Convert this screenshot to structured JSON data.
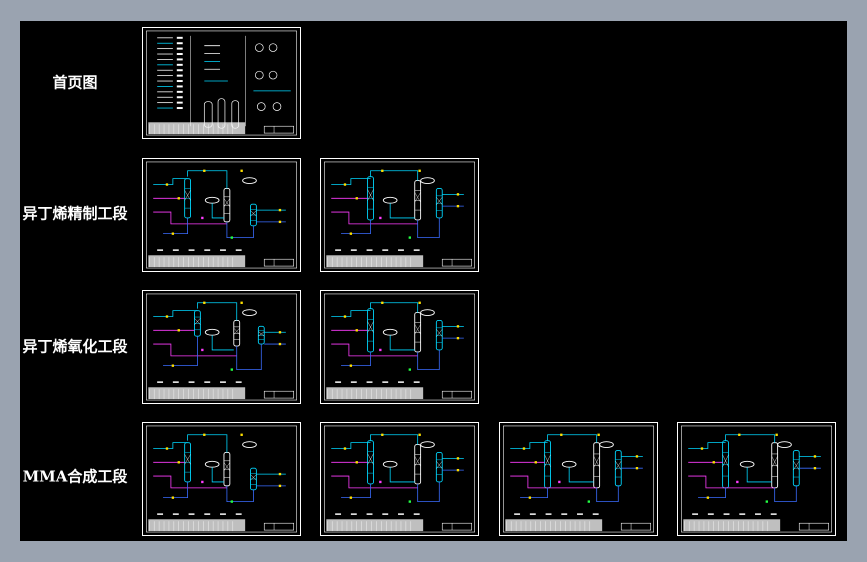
{
  "rows": [
    {
      "label": "首页图",
      "sheets": [
        "cover"
      ]
    },
    {
      "label": "异丁烯精制工段",
      "sheets": [
        "pfd-a",
        "pfd-b"
      ]
    },
    {
      "label": "异丁烯氧化工段",
      "sheets": [
        "pfd-c",
        "pfd-b"
      ]
    },
    {
      "label": "MMA合成工段",
      "sheets": [
        "pfd-a",
        "pfd-b",
        "pfd-d",
        "pfd-d"
      ]
    }
  ],
  "colors": {
    "background": "#000000",
    "frame": "#ffffff",
    "line_cyan": "#00d8ff",
    "line_blue": "#3a6cff",
    "line_magenta": "#ff3cff",
    "line_yellow": "#ffe000",
    "line_green": "#22ff44"
  }
}
